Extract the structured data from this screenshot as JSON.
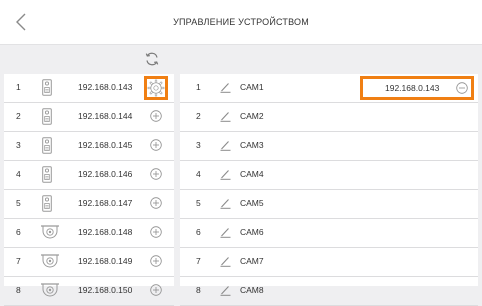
{
  "header": {
    "title": "УПРАВЛЕНИЕ УСТРОЙСТВОМ"
  },
  "devices": [
    {
      "num": "1",
      "ip": "192.168.0.143",
      "type": "intercom-icon",
      "selected": true
    },
    {
      "num": "2",
      "ip": "192.168.0.144",
      "type": "intercom-icon"
    },
    {
      "num": "3",
      "ip": "192.168.0.145",
      "type": "intercom-icon"
    },
    {
      "num": "4",
      "ip": "192.168.0.146",
      "type": "intercom-icon"
    },
    {
      "num": "5",
      "ip": "192.168.0.147",
      "type": "intercom-icon"
    },
    {
      "num": "6",
      "ip": "192.168.0.148",
      "type": "dome-camera-icon"
    },
    {
      "num": "7",
      "ip": "192.168.0.149",
      "type": "dome-camera-icon"
    },
    {
      "num": "8",
      "ip": "192.168.0.150",
      "type": "dome-camera-icon"
    }
  ],
  "cameras": [
    {
      "num": "1",
      "name": "CAM1",
      "assigned_ip": "192.168.0.143"
    },
    {
      "num": "2",
      "name": "CAM2"
    },
    {
      "num": "3",
      "name": "CAM3"
    },
    {
      "num": "4",
      "name": "CAM4"
    },
    {
      "num": "5",
      "name": "CAM5"
    },
    {
      "num": "6",
      "name": "CAM6"
    },
    {
      "num": "7",
      "name": "CAM7"
    },
    {
      "num": "8",
      "name": "CAM8"
    }
  ],
  "colors": {
    "accent": "#f07f13",
    "background": "#efeff1",
    "divider": "#dcdcde",
    "icon": "#9a9a9a"
  }
}
